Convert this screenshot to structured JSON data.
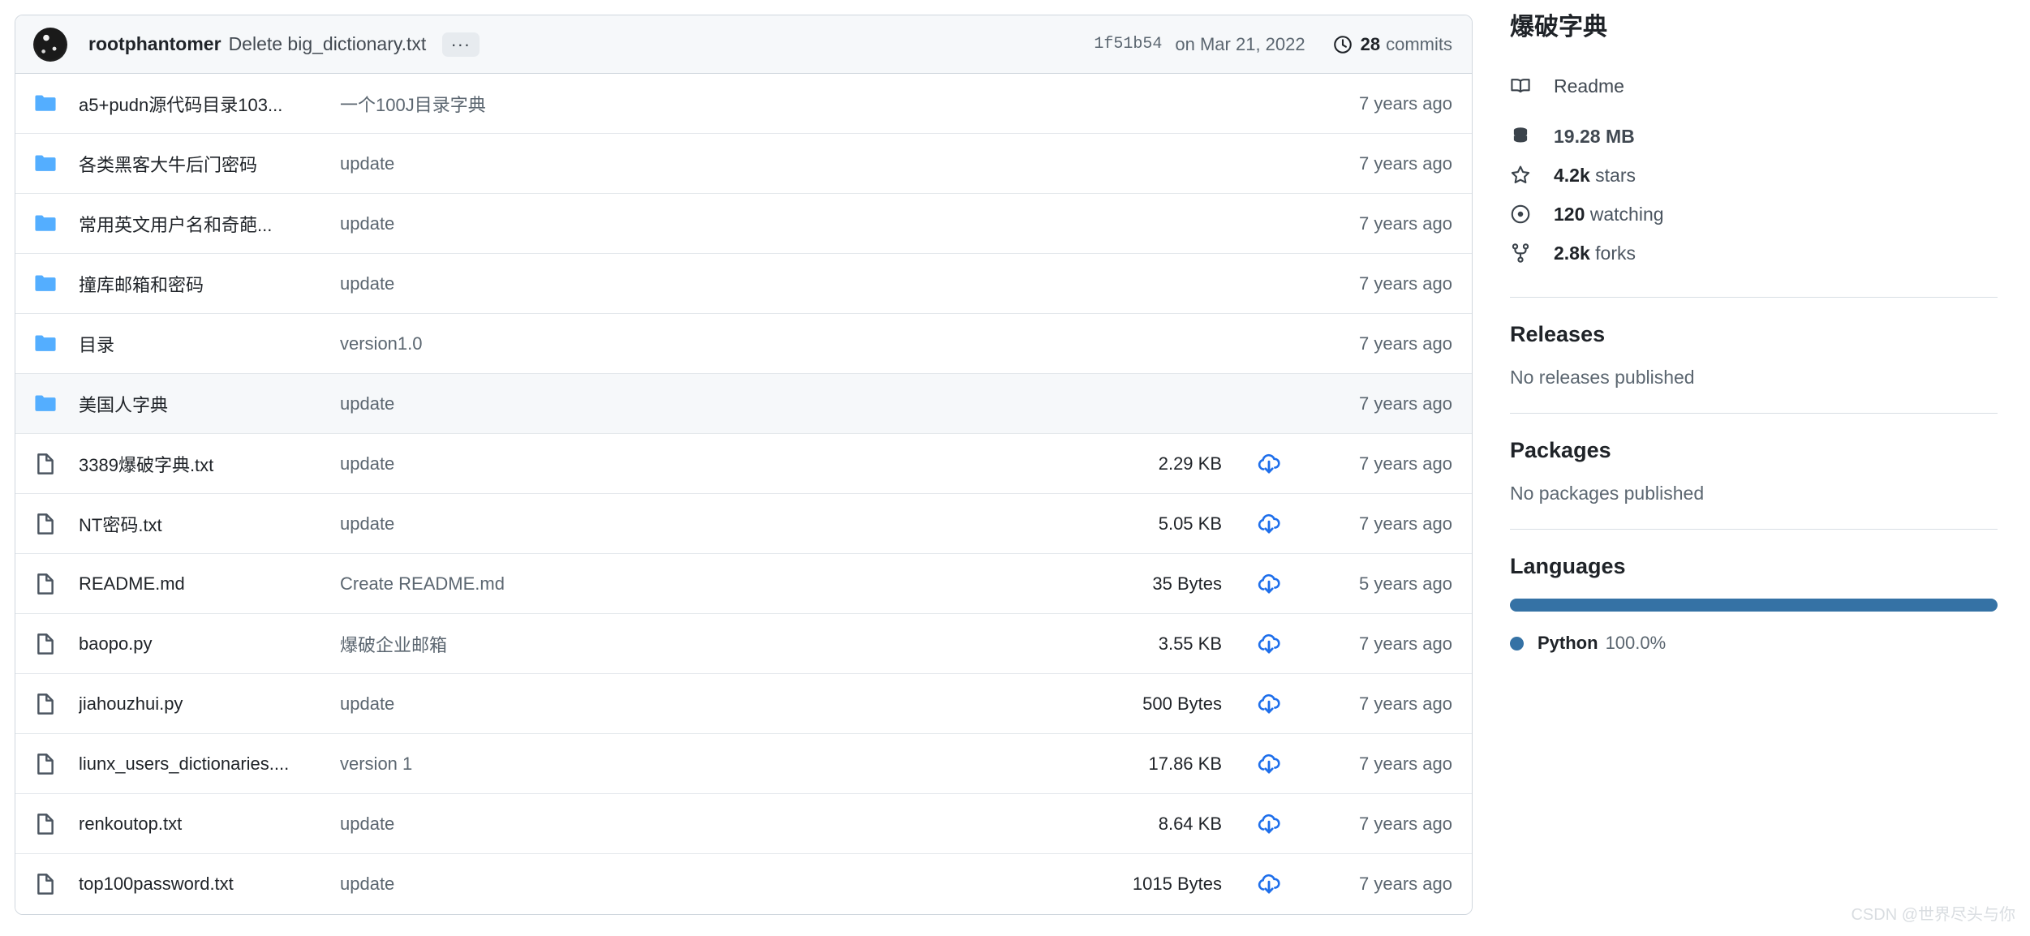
{
  "commit_header": {
    "author": "rootphantomer",
    "message": "Delete big_dictionary.txt",
    "ellipsis": "...",
    "sha": "1f51b54",
    "date": "on Mar 21, 2022",
    "commits_count": "28",
    "commits_label": "commits"
  },
  "rows": [
    {
      "type": "folder",
      "name": "a5+pudn源代码目录103...",
      "message": "一个100J目录字典",
      "size": "",
      "time": "7 years ago",
      "highlight": false
    },
    {
      "type": "folder",
      "name": "各类黑客大牛后门密码",
      "message": "update",
      "size": "",
      "time": "7 years ago",
      "highlight": false
    },
    {
      "type": "folder",
      "name": "常用英文用户名和奇葩...",
      "message": "update",
      "size": "",
      "time": "7 years ago",
      "highlight": false
    },
    {
      "type": "folder",
      "name": "撞库邮箱和密码",
      "message": "update",
      "size": "",
      "time": "7 years ago",
      "highlight": false
    },
    {
      "type": "folder",
      "name": "目录",
      "message": "version1.0",
      "size": "",
      "time": "7 years ago",
      "highlight": false
    },
    {
      "type": "folder",
      "name": "美国人字典",
      "message": "update",
      "size": "",
      "time": "7 years ago",
      "highlight": true
    },
    {
      "type": "file",
      "name": "3389爆破字典.txt",
      "message": "update",
      "size": "2.29 KB",
      "time": "7 years ago",
      "highlight": false
    },
    {
      "type": "file",
      "name": "NT密码.txt",
      "message": "update",
      "size": "5.05 KB",
      "time": "7 years ago",
      "highlight": false
    },
    {
      "type": "file",
      "name": "README.md",
      "message": "Create README.md",
      "size": "35 Bytes",
      "time": "5 years ago",
      "highlight": false
    },
    {
      "type": "file",
      "name": "baopo.py",
      "message": "爆破企业邮箱",
      "size": "3.55 KB",
      "time": "7 years ago",
      "highlight": false
    },
    {
      "type": "file",
      "name": "jiahouzhui.py",
      "message": "update",
      "size": "500 Bytes",
      "time": "7 years ago",
      "highlight": false
    },
    {
      "type": "file",
      "name": "liunx_users_dictionaries....",
      "message": "version 1",
      "size": "17.86 KB",
      "time": "7 years ago",
      "highlight": false
    },
    {
      "type": "file",
      "name": "renkoutop.txt",
      "message": "update",
      "size": "8.64 KB",
      "time": "7 years ago",
      "highlight": false
    },
    {
      "type": "file",
      "name": "top100password.txt",
      "message": "update",
      "size": "1015 Bytes",
      "time": "7 years ago",
      "highlight": false
    }
  ],
  "sidebar": {
    "repo_title": "爆破字典",
    "readme": "Readme",
    "repo_size": "19.28 MB",
    "stars_num": "4.2k",
    "stars_word": "stars",
    "watching_num": "120",
    "watching_word": "watching",
    "forks_num": "2.8k",
    "forks_word": "forks",
    "releases_title": "Releases",
    "releases_empty": "No releases published",
    "packages_title": "Packages",
    "packages_empty": "No packages published",
    "languages_title": "Languages",
    "language_name": "Python",
    "language_pct": "100.0%"
  },
  "colors": {
    "folder_blue": "#54aeff",
    "download_blue": "#1f6feb",
    "python_blue": "#3572a5"
  },
  "watermark": "CSDN @世界尽头与你"
}
